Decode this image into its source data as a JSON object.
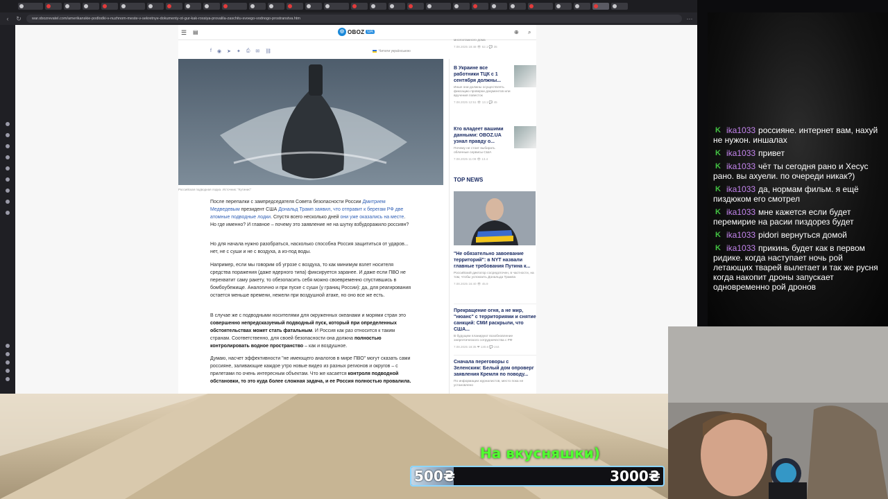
{
  "browser": {
    "url": "war.obozrevatel.com/amerikanskie-podlodki-v-nuzhnom-meste-v-sekretnye-dokumenty-ot-gur-kak-rossiya-provalila-zaschitu-svoego-vodnogo-prostranstva.htm"
  },
  "site": {
    "logo_text": "OBOZ",
    "logo_suffix": "UA",
    "read_in_ukrainian": "Читати українською",
    "photo_caption": "Российская подводная лодка. Источник: \"Кутинис\""
  },
  "article": {
    "paragraphs": [
      {
        "parts": [
          {
            "t": "После перепалки с зампредседателя Совета безопасности России "
          },
          {
            "t": "Дмитрием Медведевым",
            "link": true
          },
          {
            "t": " президент США "
          },
          {
            "t": "Дональд Трамп заявил, что отправит к берегам РФ две атомные подводные лодки",
            "link": true
          },
          {
            "t": ". Спустя всего несколько дней "
          },
          {
            "t": "они уже оказались на месте",
            "link": true
          },
          {
            "t": ". Но где именно? И главное – почему это заявление не на шутку взбудоражило россиян?"
          }
        ]
      },
      {
        "parts": [
          {
            "t": "Но для начала нужно разобраться, насколько способна Россия защититься от ударов... нет, не с суши и не с воздуха, а из-под воды."
          }
        ]
      },
      {
        "parts": [
          {
            "t": "Например, если мы говорим об угрозе с воздуха, то как минимум взлет носителя средства поражения (даже ядерного типа) фиксируется заранее. И даже если ПВО не перехватит саму ракету, то обезопасить себя можно своевременно спустившись в бомбоубежище. Аналогично и при пуске с суши (у границ России): да, для реагирования остается меньше времени, нежели при воздушной атаке, но оно все же есть."
          }
        ]
      },
      {
        "parts": [
          {
            "t": "В случае же с подводными носителями для окруженных океанами и морями стран это "
          },
          {
            "t": "совершенно непредсказуемый подводный пуск, который при определенных обстоятельствах может стать фатальным",
            "b": true
          },
          {
            "t": ". И Россия как раз относится к таким странам. Соответственно, для своей безопасности она должна "
          },
          {
            "t": "полностью контролировать водное пространство",
            "b": true
          },
          {
            "t": " – как и воздушное."
          }
        ]
      },
      {
        "parts": [
          {
            "t": "Думаю, насчет эффективности \"не имеющего аналогов в мире ПВО\" могут сказать сами россияне, заливающие каждое утро новые видео из разных регионов и округов – с прилетами по очень интересным объектам. Что же касается "
          },
          {
            "t": "контроля подводной обстановки, то это куда более сложная задача, и ее Россия полностью провалила.",
            "b": true
          }
        ]
      }
    ]
  },
  "sidebar_news": [
    {
      "title": "",
      "text": "многоэтажного дома",
      "meta": "7.08.2025 18:48  👁 52.1  💬 35"
    },
    {
      "title": "В Украине все работники ТЦК с 1 сентября должны...",
      "text": "Иные они должны осуществлять фиксацию проверки документов или вручения повесток",
      "meta": "7.08.2025 12:51  👁 13.1  💬 45"
    },
    {
      "title": "Кто владеет вашими данными: OBOZ.UA узнал правду о...",
      "text": "Почему не стоит выбирать облачные сервисы США",
      "meta": "7.08.2025 11:09  👁 13.4"
    }
  ],
  "top_news": {
    "heading": "TOP NEWS",
    "items": [
      {
        "title": "\"Не обязательно завоевание территорий\": в NYT назвали главные требования Путина к...",
        "text": "Российский диктатор сосредоточен, в частности, на том, чтобы успокоить Дональда Трампа",
        "meta": "7.08.2025 16:40  👁 45.9"
      },
      {
        "title": "Прекращение огня, а не мир, \"нюанс\" с территориями и снятие санкций: СМИ раскрыли, что США...",
        "text": "В будущем планируют возобновление энергетического сотрудничества с РФ",
        "meta": "7.08.2025 18:35  ❤ 130.6  💬 244"
      },
      {
        "title": "Сначала переговоры с Зеленским: Белый дом опроверг заявления Кремля по поводу...",
        "text": "По информации журналистов, место пока не установлено",
        "meta": ""
      }
    ]
  },
  "chat": {
    "username_color": "#c686f0",
    "badge_color": "#43c443",
    "messages": [
      {
        "user": "ika1033",
        "text": "россияне. интернет вам, нахуй не нужон. иншалах"
      },
      {
        "user": "ika1033",
        "text": "привет"
      },
      {
        "user": "ika1033",
        "text": "чёт ты сегодня рано и Хесус рано. вы ахуели. по очереди никак?)"
      },
      {
        "user": "ika1033",
        "text": "да, нормам фильм. я ещё пиздюком его смотрел"
      },
      {
        "user": "ika1033",
        "text": "мне кажется если будет перемирие на расии пиздорез будет"
      },
      {
        "user": "ika1033",
        "text": "pidori вернуться домой"
      },
      {
        "user": "ika1033",
        "text": "прикинь будет как в первом ридике. когда наступает ночь рой летающих тварей вылетает и так же русня когда накопит дроны запускает одновременно рой дронов"
      }
    ]
  },
  "donation": {
    "title": "На вкусняшки)",
    "current": "500₴",
    "goal": "3000₴",
    "progress": 0.167
  }
}
